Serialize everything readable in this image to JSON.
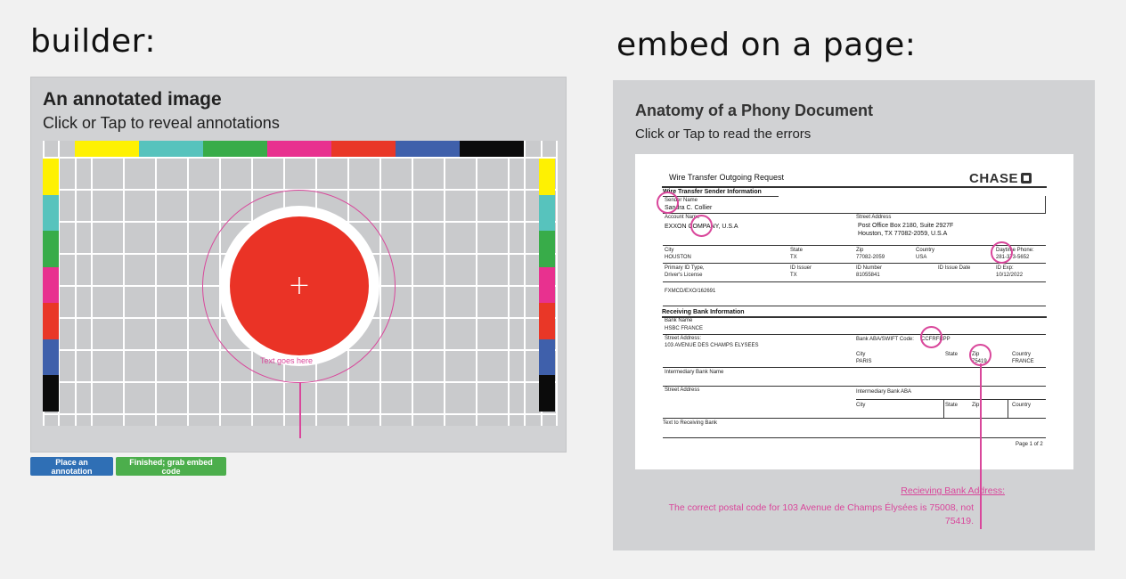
{
  "left_heading": "builder:",
  "right_heading": "embed on a page:",
  "builder": {
    "title": "An annotated image",
    "subtitle": "Click or Tap to reveal annotations",
    "annotation_text": "Text goes here",
    "place_button": "Place an annotation",
    "grab_button": "Finished; grab embed code",
    "bar_colors": [
      "#fef102",
      "#57c3bd",
      "#38ac49",
      "#e8318f",
      "#e93727",
      "#3f60ab",
      "#0b0b0b"
    ],
    "accent": "#d9479b",
    "dot_color": "#ea3326"
  },
  "embed": {
    "title": "Anatomy of a Phony Document",
    "subtitle": "Click or Tap to read the errors",
    "annotation_title": "Recieving Bank Address:",
    "annotation_body": "The correct postal code for 103 Avenue de Champs Élysées is 75008, not 75419."
  },
  "doc": {
    "title": "Wire Transfer Outgoing Request",
    "logo": "CHASE",
    "sender_section": "Wire Transfer Sender Information",
    "sender_name_label": "Sender Name",
    "sender_name": "Sandra C. Collier",
    "account_name_label": "Account Name",
    "account_name": "EXXON COMPANY, U.S.A",
    "street_label": "Street Address",
    "street_line1": "Post Office Box 2180, Suite 2927F",
    "street_line2": "Houston, TX 77082-2059, U.S.A",
    "city_label": "City",
    "city": "HOUSTON",
    "state_label": "State",
    "state": "TX",
    "zip_label": "Zip",
    "zip": "77082-2059",
    "country_label": "Country",
    "country": "USA",
    "phone_label": "Daytime Phone:",
    "phone": "281-373-5652",
    "primary_id_label": "Primary ID Type,",
    "primary_id": "Driver's License",
    "id_issuer_label": "ID Issuer",
    "id_issuer": "TX",
    "id_number_label": "ID Number",
    "id_number": "81055841",
    "issue_date_label": "ID Issue Date",
    "exp_label": "ID Exp:",
    "exp": "10/12/2022",
    "ref_code": "FXMCD/EXO/162691",
    "receiving_section": "Receiving Bank Information",
    "bank_name_label": "Bank Name",
    "bank_name": "HSBC FRANCE",
    "recv_street_label": "Street Address:",
    "recv_street": "103 AVENUE DES CHAMPS ELYSEES",
    "aba_label": "Bank ABA/SWIFT Code:",
    "aba": "CCFRFRPP",
    "recv_city": "PARIS",
    "recv_zip": "75419",
    "recv_country": "FRANCE",
    "intermediary_label": "Intermediary Bank Name",
    "intermediary_street_label": "Street Address",
    "intermediary_aba_label": "Intermediary Bank ABA",
    "text_to_recv_label": "Text to Receiving Bank",
    "page_label": "Page 1 of 2"
  }
}
